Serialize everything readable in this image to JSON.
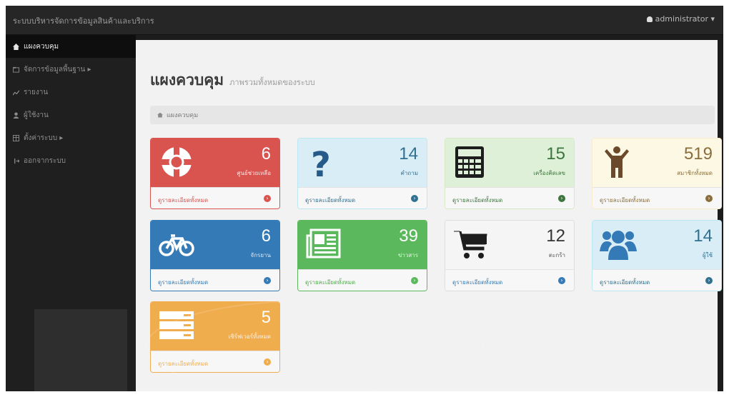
{
  "topbar": {
    "brand": "ระบบบริหารจัดการข้อมูลสินค้าและบริการ",
    "user": "administrator ▾"
  },
  "sidebar": {
    "items": [
      {
        "label": "แผงควบคุม",
        "icon": "home-icon"
      },
      {
        "label": "จัดการข้อมูลพื้นฐาน ▸",
        "icon": "folder-icon"
      },
      {
        "label": "รายงาน",
        "icon": "chart-icon"
      },
      {
        "label": "ผู้ใช้งาน",
        "icon": "user-icon"
      },
      {
        "label": "ตั้งค่าระบบ ▸",
        "icon": "table-icon"
      },
      {
        "label": "ออกจากระบบ",
        "icon": "logout-icon"
      }
    ]
  },
  "page": {
    "title": "แผงควบคุม",
    "subtitle": "ภาพรวมทั้งหมดของระบบ",
    "breadcrumb": "แผงควบคุม"
  },
  "colors": {
    "red": "#d9534f",
    "blue_light": "#d9edf7",
    "green_light": "#dff0d8",
    "yellow_light": "#fcf8e3",
    "blue": "#337ab7",
    "green": "#5cb85c",
    "gray_light": "#f5f5f5",
    "orange": "#f0ad4e"
  },
  "panels": [
    {
      "count": "6",
      "label": "ศูนย์ช่วยเหลือ",
      "link": "ดูรายละเอียดทั้งหมด",
      "icon": "life-ring-icon"
    },
    {
      "count": "14",
      "label": "คำถาม",
      "link": "ดูรายละเอียดทั้งหมด",
      "icon": "question-icon"
    },
    {
      "count": "15",
      "label": "เครื่องคิดเลข",
      "link": "ดูรายละเอียดทั้งหมด",
      "icon": "calculator-icon"
    },
    {
      "count": "519",
      "label": "สมาชิกทั้งหมด",
      "link": "ดูรายละเอียดทั้งหมด",
      "icon": "child-icon"
    },
    {
      "count": "6",
      "label": "จักรยาน",
      "link": "ดูรายละเอียดทั้งหมด",
      "icon": "bicycle-icon"
    },
    {
      "count": "39",
      "label": "ข่าวสาร",
      "link": "ดูรายละเอียดทั้งหมด",
      "icon": "newspaper-icon"
    },
    {
      "count": "12",
      "label": "ตะกร้า",
      "link": "ดูรายละเอียดทั้งหมด",
      "icon": "cart-icon"
    },
    {
      "count": "14",
      "label": "ผู้ใช้",
      "link": "ดูรายละเอียดทั้งหมด",
      "icon": "users-icon"
    },
    {
      "count": "5",
      "label": "เซิร์ฟเวอร์ทั้งหมด",
      "link": "ดูรายละเอียดทั้งหมด",
      "icon": "server-icon"
    }
  ]
}
